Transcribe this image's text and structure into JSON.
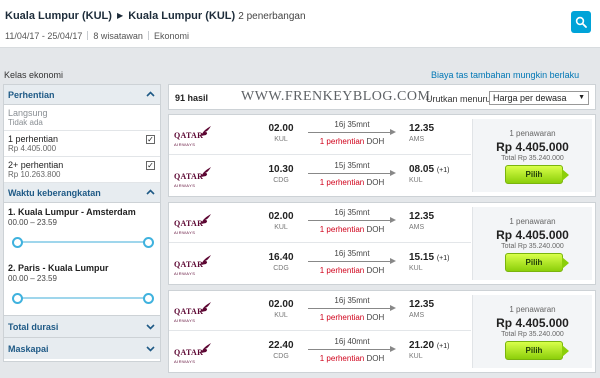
{
  "header": {
    "origin": "Kuala Lumpur (KUL)",
    "destination": "Kuala Lumpur (KUL)",
    "flight_count": "2 penerbangan",
    "dates": "11/04/17 - 25/04/17",
    "travelers": "8 wisatawan",
    "cabin": "Ekonomi"
  },
  "cabin_label": "Kelas ekonomi",
  "baggage_link": "Biaya tas tambahan mungkin berlaku",
  "sidebar": {
    "stops_title": "Perhentian",
    "stops": [
      {
        "label": "Langsung",
        "price": "Tidak ada",
        "checked": false,
        "disabled": true
      },
      {
        "label": "1 perhentian",
        "price": "Rp 4.405.000",
        "checked": true,
        "disabled": false
      },
      {
        "label": "2+ perhentian",
        "price": "Rp 10.263.800",
        "checked": true,
        "disabled": false
      }
    ],
    "time_title": "Waktu keberangkatan",
    "time_filters": [
      {
        "route": "1. Kuala Lumpur - Amsterdam",
        "range": "00.00 – 23.59"
      },
      {
        "route": "2. Paris - Kuala Lumpur",
        "range": "00.00 – 23.59"
      }
    ],
    "duration_title": "Total durasi",
    "airline_title": "Maskapai"
  },
  "results": {
    "count": "91 hasil",
    "watermark": "WWW.FRENKEYBLOG.COM",
    "sort_label": "Urutkan menurut",
    "sort_value": "Harga per dewasa",
    "cards": [
      {
        "airline": "QATAR",
        "airline_sub": "AIRWAYS",
        "outbound": {
          "dep_time": "02.00",
          "dep_code": "KUL",
          "duration": "16j 35mnt",
          "stops": "1 perhentian",
          "via": "DOH",
          "arr_time": "12.35",
          "arr_plus": "",
          "arr_code": "AMS"
        },
        "inbound": {
          "dep_time": "10.30",
          "dep_code": "CDG",
          "duration": "15j 35mnt",
          "stops": "1 perhentian",
          "via": "DOH",
          "arr_time": "08.05",
          "arr_plus": "(+1)",
          "arr_code": "KUL"
        },
        "offers": "1 penawaran",
        "price": "Rp 4.405.000",
        "total": "Total Rp 35.240.000",
        "button": "Pilih"
      },
      {
        "airline": "QATAR",
        "airline_sub": "AIRWAYS",
        "outbound": {
          "dep_time": "02.00",
          "dep_code": "KUL",
          "duration": "16j 35mnt",
          "stops": "1 perhentian",
          "via": "DOH",
          "arr_time": "12.35",
          "arr_plus": "",
          "arr_code": "AMS"
        },
        "inbound": {
          "dep_time": "16.40",
          "dep_code": "CDG",
          "duration": "16j 35mnt",
          "stops": "1 perhentian",
          "via": "DOH",
          "arr_time": "15.15",
          "arr_plus": "(+1)",
          "arr_code": "KUL"
        },
        "offers": "1 penawaran",
        "price": "Rp 4.405.000",
        "total": "Total Rp 35.240.000",
        "button": "Pilih"
      },
      {
        "airline": "QATAR",
        "airline_sub": "AIRWAYS",
        "outbound": {
          "dep_time": "02.00",
          "dep_code": "KUL",
          "duration": "16j 35mnt",
          "stops": "1 perhentian",
          "via": "DOH",
          "arr_time": "12.35",
          "arr_plus": "",
          "arr_code": "AMS"
        },
        "inbound": {
          "dep_time": "22.40",
          "dep_code": "CDG",
          "duration": "16j 40mnt",
          "stops": "1 perhentian",
          "via": "DOH",
          "arr_time": "21.20",
          "arr_plus": "(+1)",
          "arr_code": "KUL"
        },
        "offers": "1 penawaran",
        "price": "Rp 4.405.000",
        "total": "Total Rp 35.240.000",
        "button": "Pilih"
      }
    ]
  },
  "colors": {
    "accent": "#00a3d8",
    "link": "#0077b5",
    "stop_red": "#d0021b",
    "button_green": "#8ccf0a",
    "airline_maroon": "#5c0632"
  }
}
